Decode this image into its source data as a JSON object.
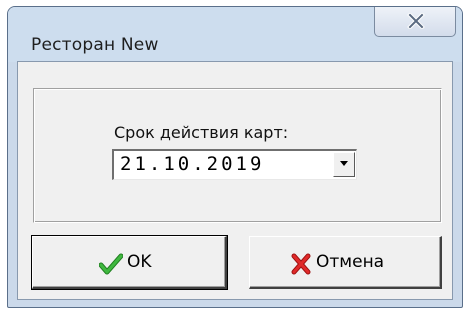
{
  "window": {
    "title": "Ресторан New"
  },
  "form": {
    "label": "Срок действия карт:",
    "date_value": "21.10.2019"
  },
  "buttons": {
    "ok_label": "OK",
    "cancel_label": "Отмена"
  },
  "icons": {
    "close": "close-icon",
    "dropdown": "chevron-down-icon",
    "ok": "checkmark-icon",
    "cancel": "red-x-icon"
  },
  "colors": {
    "titlebar": "#cdddee",
    "client": "#f0f0f0",
    "ok_icon": "#2f9b2f",
    "cancel_icon": "#d42121"
  }
}
